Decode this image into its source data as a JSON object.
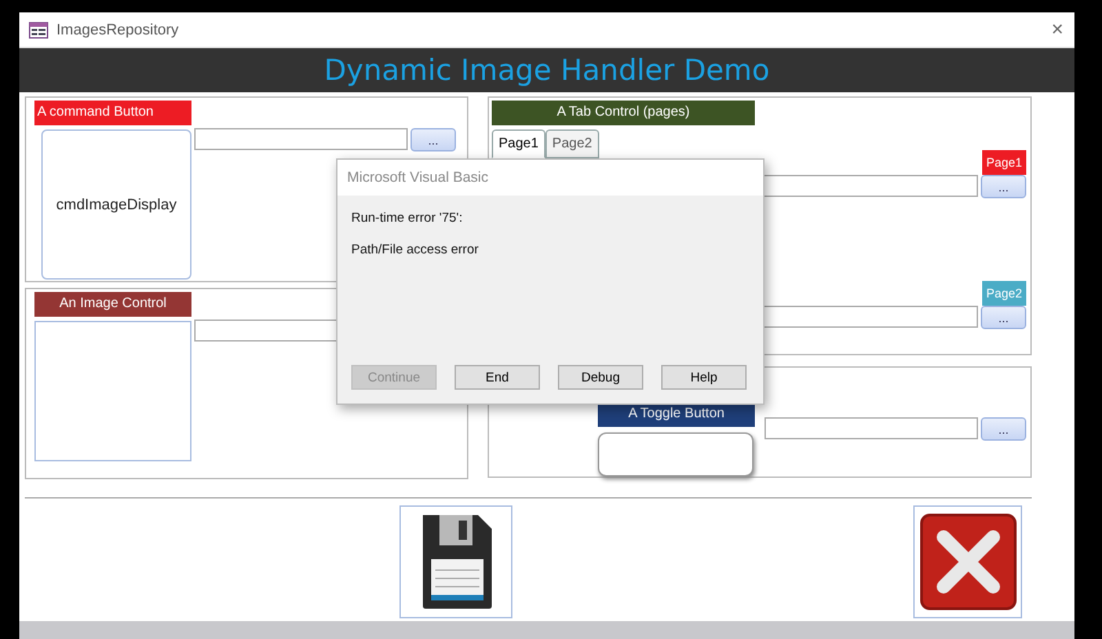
{
  "window": {
    "title": "ImagesRepository",
    "close": "×"
  },
  "header": {
    "title": "Dynamic Image Handler Demo"
  },
  "command_section": {
    "label": "A command Button",
    "button_caption": "cmdImageDisplay",
    "browse_button": "..."
  },
  "image_section": {
    "label": "An Image Control"
  },
  "tab_section": {
    "label": "A Tab Control (pages)",
    "tabs": [
      {
        "label": "Page1",
        "selected": true
      },
      {
        "label": "Page2",
        "selected": false
      }
    ],
    "pages": [
      {
        "label": "Page1",
        "color": "#ed1c24",
        "browse_button": "..."
      },
      {
        "label": "Page2",
        "color": "#4bacc6",
        "browse_button": "..."
      }
    ]
  },
  "toggle_section": {
    "label": "A Toggle Button",
    "browse_button": "..."
  },
  "dialog": {
    "title": "Microsoft Visual Basic",
    "lines": [
      "Run-time error '75':",
      "Path/File access error"
    ],
    "buttons": [
      {
        "label": "Continue",
        "disabled": true
      },
      {
        "label": "End",
        "disabled": false
      },
      {
        "label": "Debug",
        "disabled": false
      },
      {
        "label": "Help",
        "disabled": false
      }
    ]
  }
}
